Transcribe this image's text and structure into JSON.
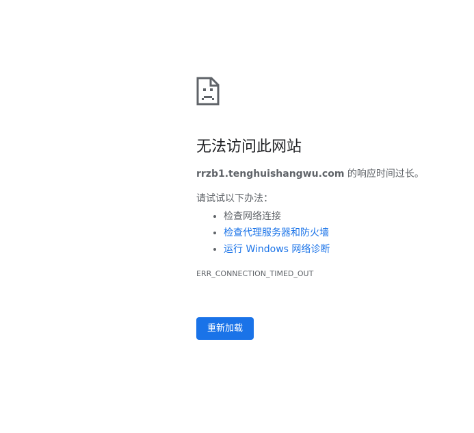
{
  "error_page": {
    "icon": "sad-page-icon",
    "title": "无法访问此网站",
    "summary": {
      "host": "rrzb1.tenghuishangwu.com",
      "suffix": " 的响应时间过长。"
    },
    "suggestions_label": "请试试以下办法：",
    "suggestions": [
      {
        "label": "检查网络连接",
        "link": false
      },
      {
        "label": "检查代理服务器和防火墙",
        "link": true
      },
      {
        "label": "运行 Windows 网络诊断",
        "link": true
      }
    ],
    "error_code": "ERR_CONNECTION_TIMED_OUT",
    "reload_label": "重新加载"
  },
  "colors": {
    "text": "#202124",
    "secondary_text": "#5f6368",
    "link": "#1a73e8",
    "button_bg": "#1a73e8",
    "button_text": "#ffffff"
  }
}
